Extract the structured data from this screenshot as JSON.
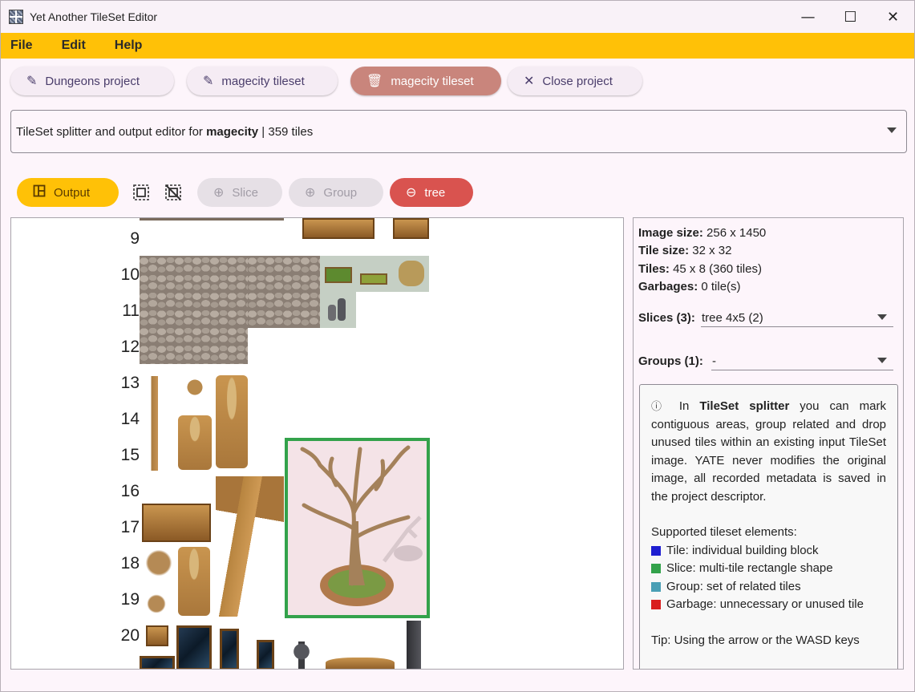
{
  "window": {
    "title": "Yet Another TileSet Editor",
    "minimize": "—",
    "maximize": "☐",
    "close": "✕"
  },
  "menu": [
    "File",
    "Edit",
    "Help"
  ],
  "tabs": [
    {
      "icon": "✎",
      "label": "Dungeons project"
    },
    {
      "icon": "✎",
      "label": "magecity tileset"
    },
    {
      "icon": "🗑",
      "label": "magecity tileset"
    },
    {
      "icon": "✕",
      "label": "Close project"
    }
  ],
  "project_combo": {
    "prefix": "TileSet splitter and output editor for ",
    "name": "magecity",
    "suffix": " | 359 tiles"
  },
  "toolbar": {
    "output": "Output",
    "slice": "Slice",
    "group": "Group",
    "tree": "tree"
  },
  "rows": [
    "9",
    "10",
    "11",
    "12",
    "13",
    "14",
    "15",
    "16",
    "17",
    "18",
    "19",
    "20"
  ],
  "info": {
    "image_size_label": "Image size:",
    "image_size": " 256 x 1450",
    "tile_size_label": "Tile size:",
    "tile_size": " 32 x 32",
    "tiles_label": "Tiles:",
    "tiles": " 45 x 8 (360 tiles)",
    "garbages_label": "Garbages:",
    "garbages": " 0 tile(s)",
    "slices_label": "Slices (3):",
    "slices_value": "tree 4x5 (2)",
    "groups_label": "Groups (1):",
    "groups_value": "-"
  },
  "help": {
    "intro_a": " In ",
    "intro_bold": "TileSet splitter",
    "intro_b": " you can mark contiguous areas, group related and drop unused tiles within an existing input TileSet image. YATE never modifies the original image, all recorded metadata is saved in the project descriptor.",
    "supported": "Supported tileset elements:",
    "legend": [
      {
        "color": "#1f1fd1",
        "text": "Tile: individual building block"
      },
      {
        "color": "#33a24b",
        "text": "Slice: multi-tile rectangle shape"
      },
      {
        "color": "#4a9fb5",
        "text": "Group: set of related tiles"
      },
      {
        "color": "#d91f1f",
        "text": "Garbage: unnecessary or unused tile"
      }
    ],
    "tip": "Tip: Using the arrow or the WASD keys"
  }
}
